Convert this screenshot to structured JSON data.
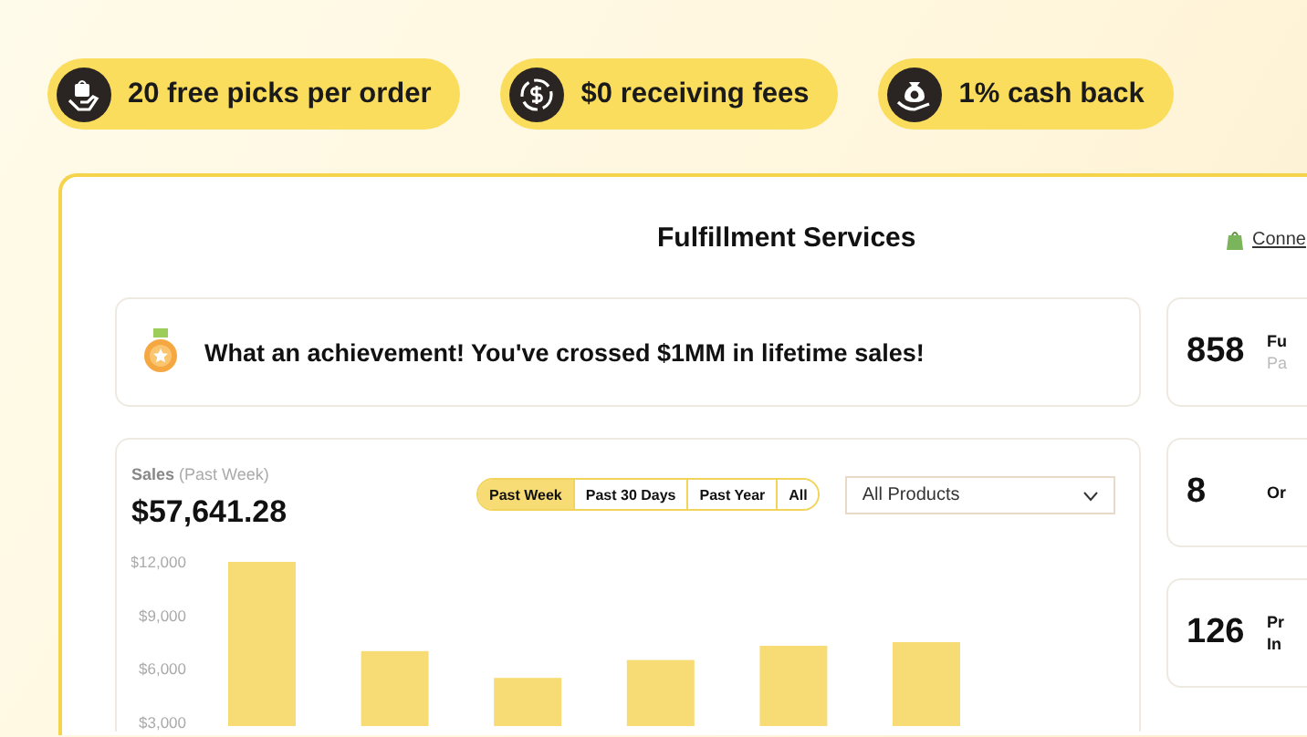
{
  "perks": [
    {
      "kind": "picks",
      "label": "20 free picks per order"
    },
    {
      "kind": "fees",
      "label": "$0 receiving fees"
    },
    {
      "kind": "cashback",
      "label": "1% cash back"
    }
  ],
  "header": {
    "title": "Fulfillment Services",
    "connect_link": "Conne"
  },
  "achievement": {
    "message": "What an achievement! You've crossed $1MM in lifetime sales!"
  },
  "sales": {
    "label": "Sales",
    "period_note": "(Past Week)",
    "total": "$57,641.28",
    "periods": [
      {
        "label": "Past Week",
        "selected": true
      },
      {
        "label": "Past 30 Days",
        "selected": false
      },
      {
        "label": "Past Year",
        "selected": false
      },
      {
        "label": "All",
        "selected": false
      }
    ],
    "product_filter": {
      "value": "All Products"
    },
    "chart_data": {
      "type": "bar",
      "ylim": [
        2800,
        12000
      ],
      "yticks": [
        {
          "value": 3000,
          "label": "$3,000"
        },
        {
          "value": 6000,
          "label": "$6,000"
        },
        {
          "value": 9000,
          "label": "$9,000"
        },
        {
          "value": 12000,
          "label": "$12,000"
        }
      ],
      "series": [
        {
          "color": "#f7dc75",
          "values": [
            12000,
            7000,
            5500,
            6500,
            7300,
            7500
          ]
        }
      ]
    }
  },
  "stats": [
    {
      "value": "858",
      "title": "Fu",
      "subtitle": "Pa"
    },
    {
      "value": "8",
      "title": "Or"
    },
    {
      "value": "126",
      "title": "Pr",
      "title_line_2": "In"
    }
  ]
}
